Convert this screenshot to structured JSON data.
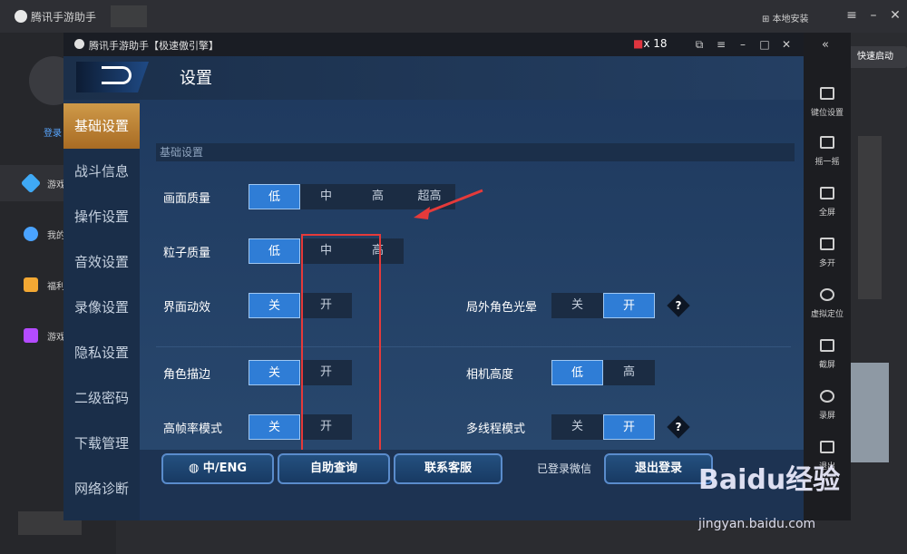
{
  "outer": {
    "title": "腾讯手游助手",
    "install_label": "本地安装",
    "quick_start": "快速启动",
    "login_label": "登录",
    "nav": [
      {
        "label": "游戏",
        "icon": "game-cube-icon",
        "color": "#3fa9f5"
      },
      {
        "label": "我的",
        "icon": "gamepad-icon",
        "color": "#4aa3ff"
      },
      {
        "label": "福利",
        "icon": "gift-icon",
        "color": "#f3a833"
      },
      {
        "label": "游戏",
        "icon": "video-icon",
        "color": "#b44bff"
      }
    ]
  },
  "dialog": {
    "title": "腾讯手游助手【极速傲引擎】",
    "gift_count": "x 18",
    "header_title": "设置",
    "section_label": "基础设置",
    "nav": [
      "基础设置",
      "战斗信息",
      "操作设置",
      "音效设置",
      "录像设置",
      "隐私设置",
      "二级密码",
      "下载管理",
      "网络诊断"
    ],
    "active_nav": 0,
    "rows": {
      "picture_quality": {
        "label": "画面质量",
        "options": [
          "低",
          "中",
          "高",
          "超高"
        ],
        "selected": 0
      },
      "particle_quality": {
        "label": "粒子质量",
        "options": [
          "低",
          "中",
          "高"
        ],
        "selected": 0
      },
      "ui_animation": {
        "label": "界面动效",
        "options": [
          "关",
          "开"
        ],
        "selected": 0
      },
      "outside_glow": {
        "label": "局外角色光晕",
        "options": [
          "关",
          "开"
        ],
        "selected": 1
      },
      "character_outline": {
        "label": "角色描边",
        "options": [
          "关",
          "开"
        ],
        "selected": 0
      },
      "camera_height": {
        "label": "相机高度",
        "options": [
          "低",
          "高"
        ],
        "selected": 0
      },
      "high_fps": {
        "label": "高帧率模式",
        "options": [
          "关",
          "开"
        ],
        "selected": 0
      },
      "multithread": {
        "label": "多线程模式",
        "options": [
          "关",
          "开"
        ],
        "selected": 1
      }
    },
    "help_icon": "?",
    "footer": {
      "lang_label": "中/ENG",
      "self_help": "自助查询",
      "contact": "联系客服",
      "wechat_status": "已登录微信",
      "logout": "退出登录"
    }
  },
  "toolbar": [
    {
      "label": "键位设置",
      "icon": "keyboard-icon"
    },
    {
      "label": "摇一摇",
      "icon": "shake-icon"
    },
    {
      "label": "全屏",
      "icon": "fullscreen-icon"
    },
    {
      "label": "多开",
      "icon": "multi-window-icon"
    },
    {
      "label": "虚拟定位",
      "icon": "location-icon"
    },
    {
      "label": "截屏",
      "icon": "screenshot-icon"
    },
    {
      "label": "录屏",
      "icon": "record-icon"
    },
    {
      "label": "退出",
      "icon": "exit-icon"
    }
  ],
  "watermark": {
    "brand": "Baidu经验",
    "url": "jingyan.baidu.com"
  },
  "colors": {
    "accent": "#2f7dd6",
    "active_nav": "#cf9a49",
    "annotation": "#e53a3a"
  }
}
